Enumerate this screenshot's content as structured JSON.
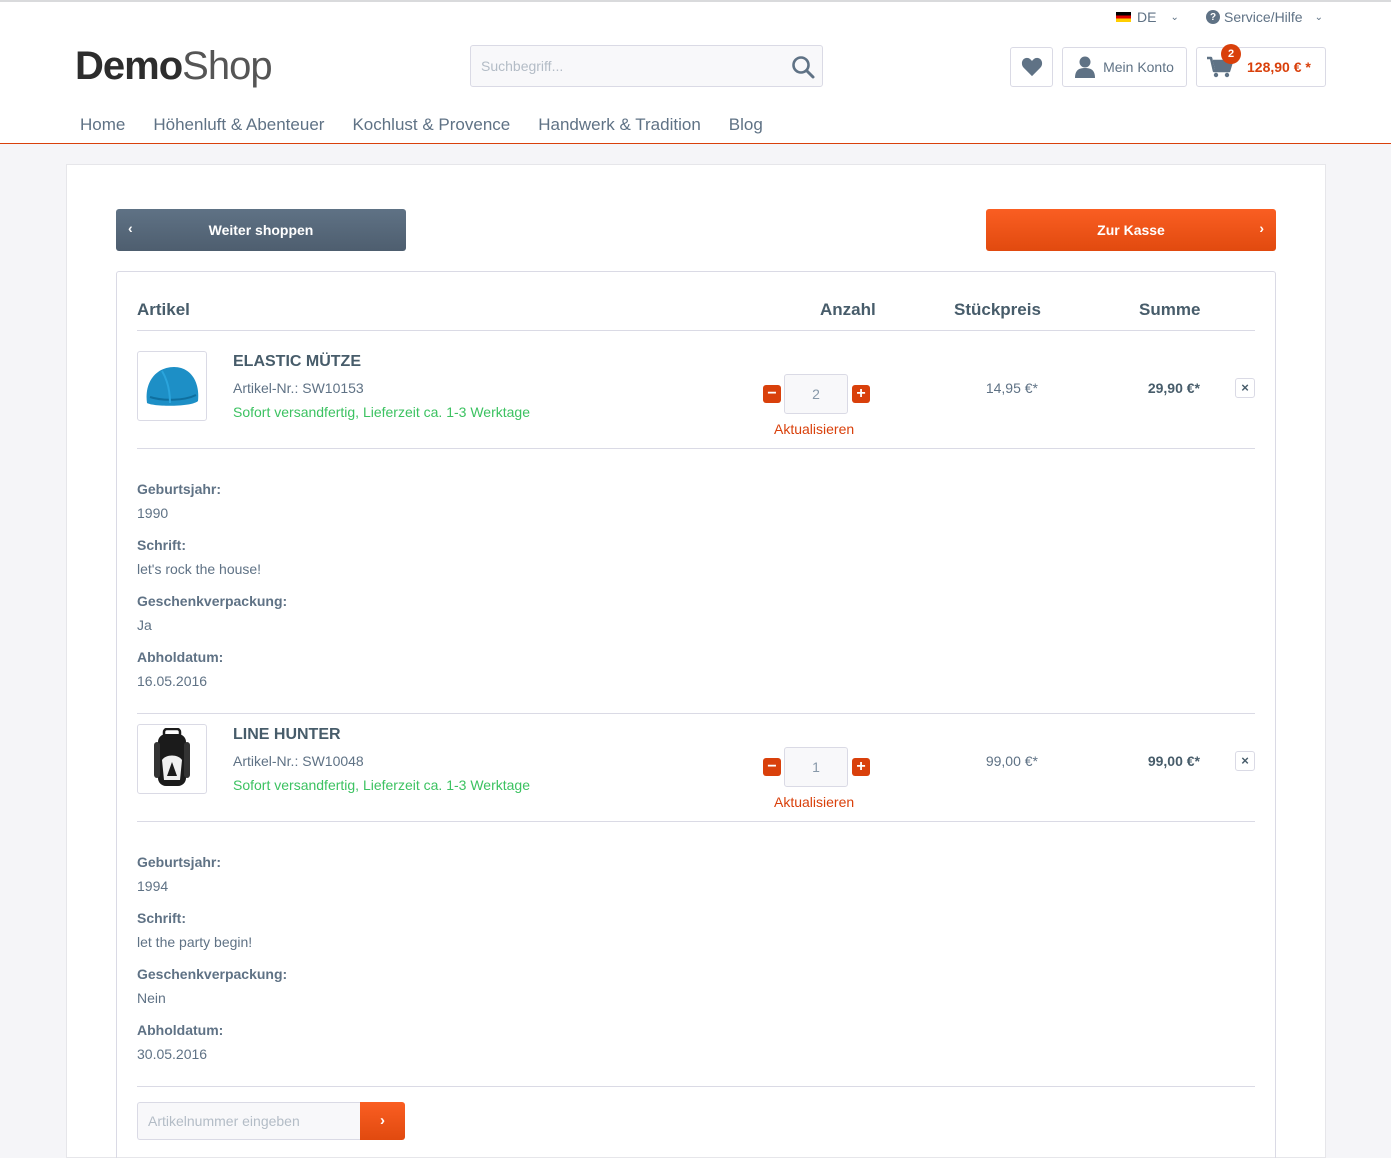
{
  "topbar": {
    "language": "DE",
    "service": "Service/Hilfe"
  },
  "logo": {
    "bold": "Demo",
    "light": "Shop"
  },
  "search": {
    "placeholder": "Suchbegriff..."
  },
  "account": {
    "label": "Mein Konto"
  },
  "cart": {
    "count": "2",
    "amount": "128,90 € *"
  },
  "nav": [
    "Home",
    "Höhenluft & Abenteuer",
    "Kochlust & Provence",
    "Handwerk & Tradition",
    "Blog"
  ],
  "actions": {
    "back": "Weiter shoppen",
    "checkout": "Zur Kasse"
  },
  "table": {
    "headers": {
      "article": "Artikel",
      "quantity": "Anzahl",
      "unit_price": "Stückpreis",
      "total": "Summe"
    }
  },
  "items": [
    {
      "name": "ELASTIC MÜTZE",
      "sku": "Artikel-Nr.: SW10153",
      "delivery": "Sofort versandfertig, Lieferzeit ca. 1-3 Werktage",
      "quantity": "2",
      "update": "Aktualisieren",
      "unit_price": "14,95 €*",
      "total": "29,90 €*",
      "options": [
        {
          "label": "Geburtsjahr:",
          "value": "1990"
        },
        {
          "label": "Schrift:",
          "value": "let's rock the house!"
        },
        {
          "label": "Geschenkverpackung:",
          "value": "Ja"
        },
        {
          "label": "Abholdatum:",
          "value": "16.05.2016"
        }
      ]
    },
    {
      "name": "LINE HUNTER",
      "sku": "Artikel-Nr.: SW10048",
      "delivery": "Sofort versandfertig, Lieferzeit ca. 1-3 Werktage",
      "quantity": "1",
      "update": "Aktualisieren",
      "unit_price": "99,00 €*",
      "total": "99,00 €*",
      "options": [
        {
          "label": "Geburtsjahr:",
          "value": "1994"
        },
        {
          "label": "Schrift:",
          "value": "let the party begin!"
        },
        {
          "label": "Geschenkverpackung:",
          "value": "Nein"
        },
        {
          "label": "Abholdatum:",
          "value": "30.05.2016"
        }
      ]
    }
  ],
  "add_by_sku": {
    "placeholder": "Artikelnummer eingeben",
    "button": "›"
  },
  "colors": {
    "accent": "#d9400b",
    "text": "#5f7285",
    "success": "#3cc261"
  }
}
